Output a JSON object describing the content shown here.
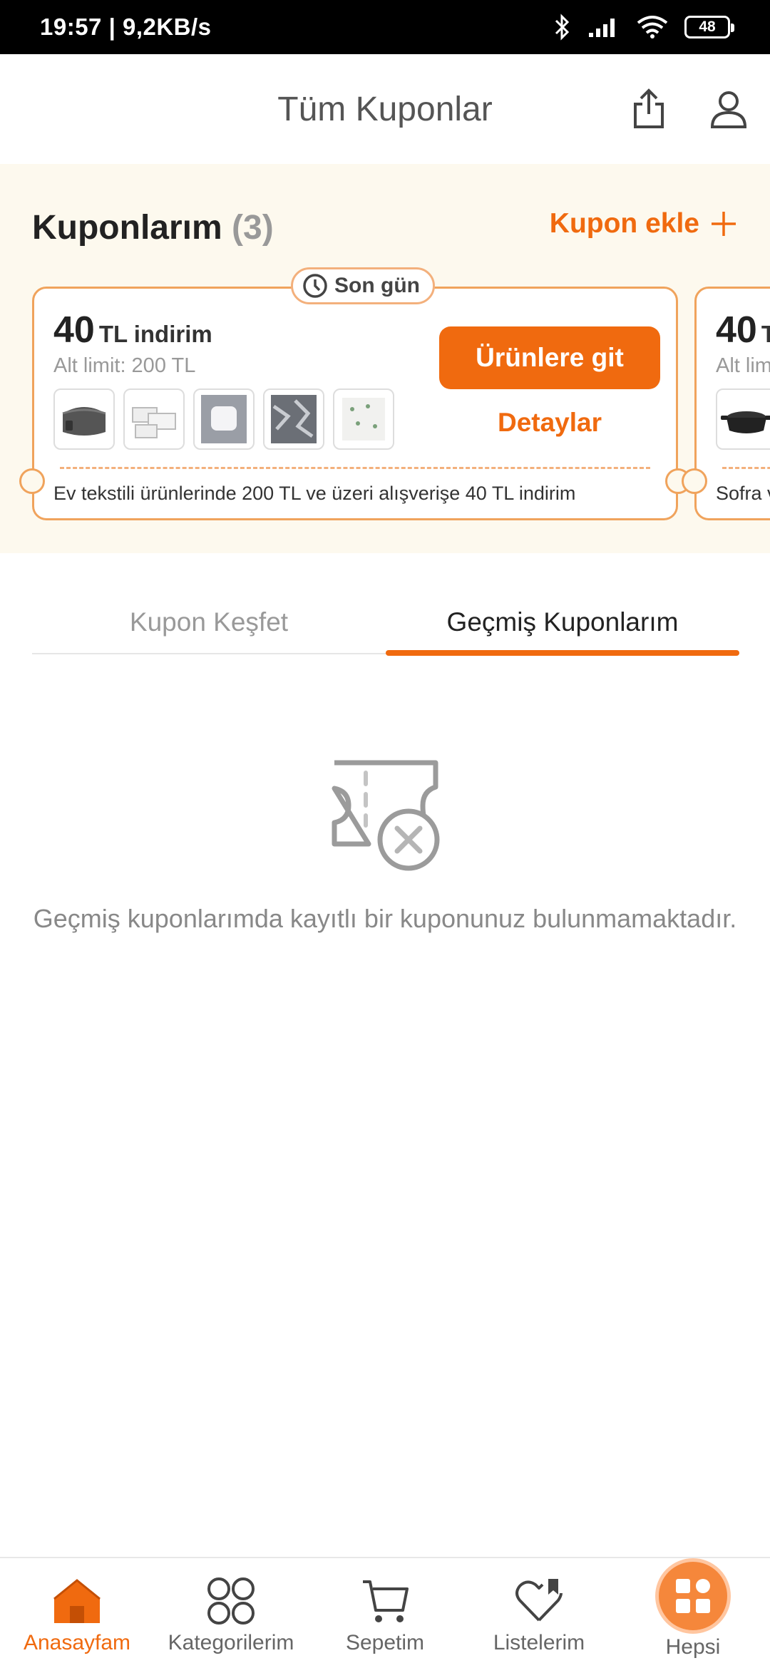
{
  "status_bar": {
    "time_speed": "19:57 | 9,2KB/s",
    "battery": "48"
  },
  "header": {
    "title": "Tüm Kuponlar"
  },
  "coupons": {
    "title": "Kuponlarım",
    "count": "(3)",
    "add_label": "Kupon ekle",
    "cards": [
      {
        "badge": "Son gün",
        "amount": "40",
        "unit": "TL indirim",
        "min_limit": "Alt limit: 200 TL",
        "go_label": "Ürünlere git",
        "details_label": "Detaylar",
        "description": "Ev tekstili ürünlerinde 200 TL ve üzeri alışverişe 40 TL indirim"
      },
      {
        "amount": "40",
        "unit": "TL indirim",
        "min_limit": "Alt limit",
        "description": "Sofra ve mutfak"
      }
    ]
  },
  "tabs": [
    {
      "label": "Kupon Keşfet"
    },
    {
      "label": "Geçmiş Kuponlarım"
    }
  ],
  "empty_state": {
    "message": "Geçmiş kuponlarımda kayıtlı bir kuponunuz bulunmamaktadır."
  },
  "bottom_nav": [
    {
      "label": "Anasayfam"
    },
    {
      "label": "Kategorilerim"
    },
    {
      "label": "Sepetim"
    },
    {
      "label": "Listelerim"
    },
    {
      "label": "Hepsi"
    }
  ],
  "colors": {
    "accent": "#f06a0f",
    "coupon_bg": "#fdf9ee",
    "coupon_border": "#f0a35c"
  }
}
